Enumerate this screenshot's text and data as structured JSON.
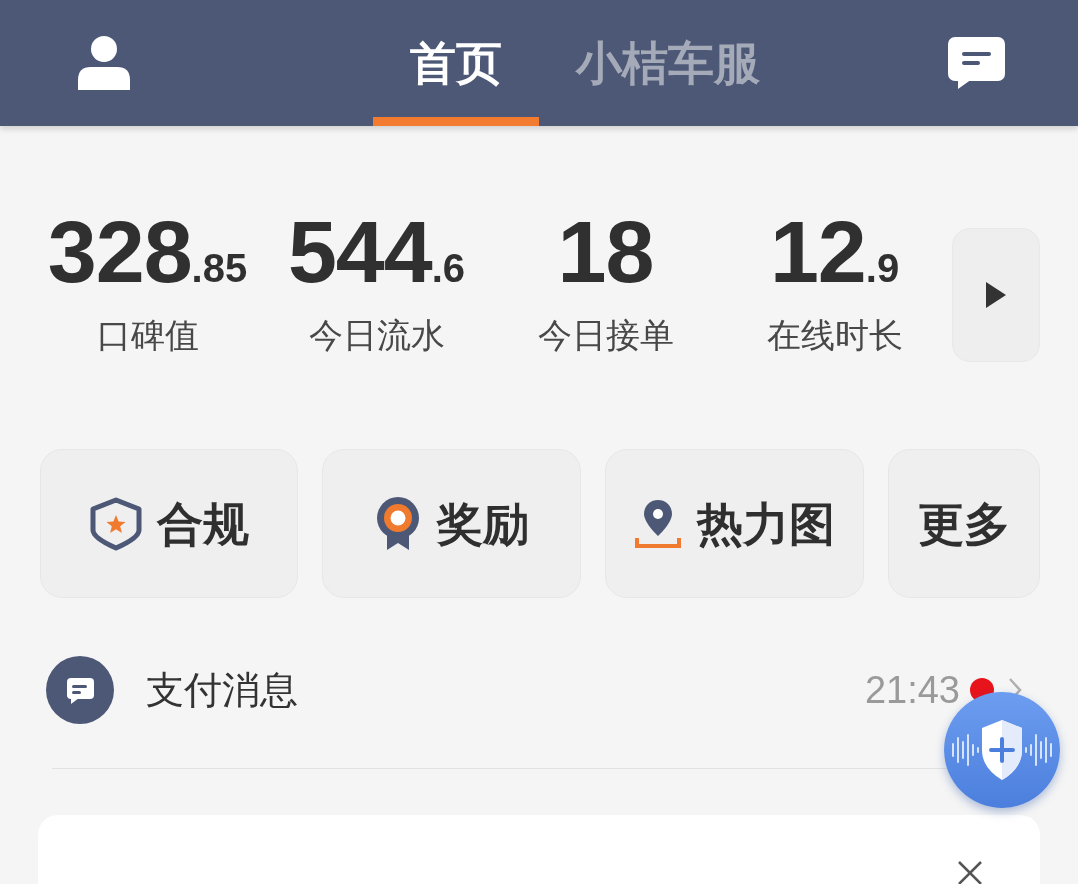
{
  "header": {
    "tabs": [
      {
        "label": "首页",
        "selected": true
      },
      {
        "label": "小桔车服",
        "selected": false
      }
    ]
  },
  "stats": [
    {
      "value": "328",
      "decimal": ".85",
      "label": "口碑值"
    },
    {
      "value": "544",
      "decimal": ".6",
      "label": "今日流水"
    },
    {
      "value": "18",
      "label": "今日接单"
    },
    {
      "value": "12",
      "decimal": ".9",
      "label": "在线时长"
    }
  ],
  "shortcuts": [
    {
      "label": "合规"
    },
    {
      "label": "奖励"
    },
    {
      "label": "热力图"
    },
    {
      "label": "更多"
    }
  ],
  "message": {
    "title": "支付消息",
    "time": "21:43",
    "unread": true
  }
}
